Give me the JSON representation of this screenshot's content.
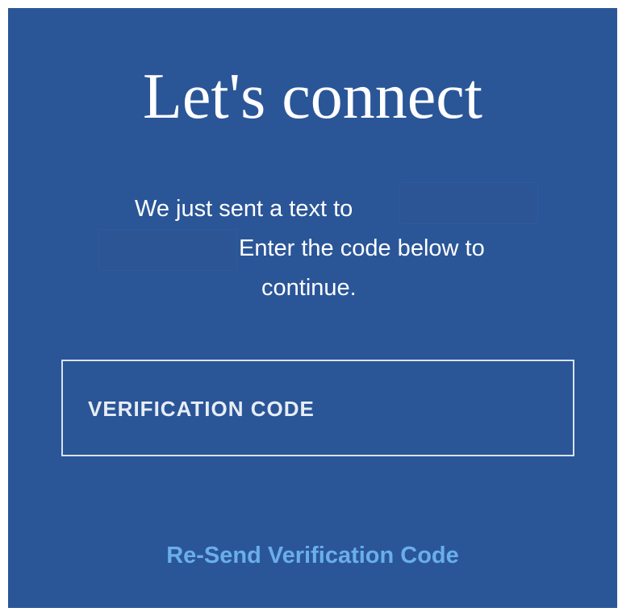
{
  "screen": {
    "title": "Let's connect",
    "message_line_1": "We just sent a text to",
    "message_line_2": "Enter the code below to",
    "message_line_3": "continue.",
    "verification_field": {
      "placeholder": "VERIFICATION CODE",
      "value": ""
    },
    "resend_link": "Re-Send Verification Code"
  },
  "colors": {
    "background": "#2a5698",
    "text": "#ffffff",
    "link": "#6aaeea",
    "field_border": "#d9e2ee"
  }
}
